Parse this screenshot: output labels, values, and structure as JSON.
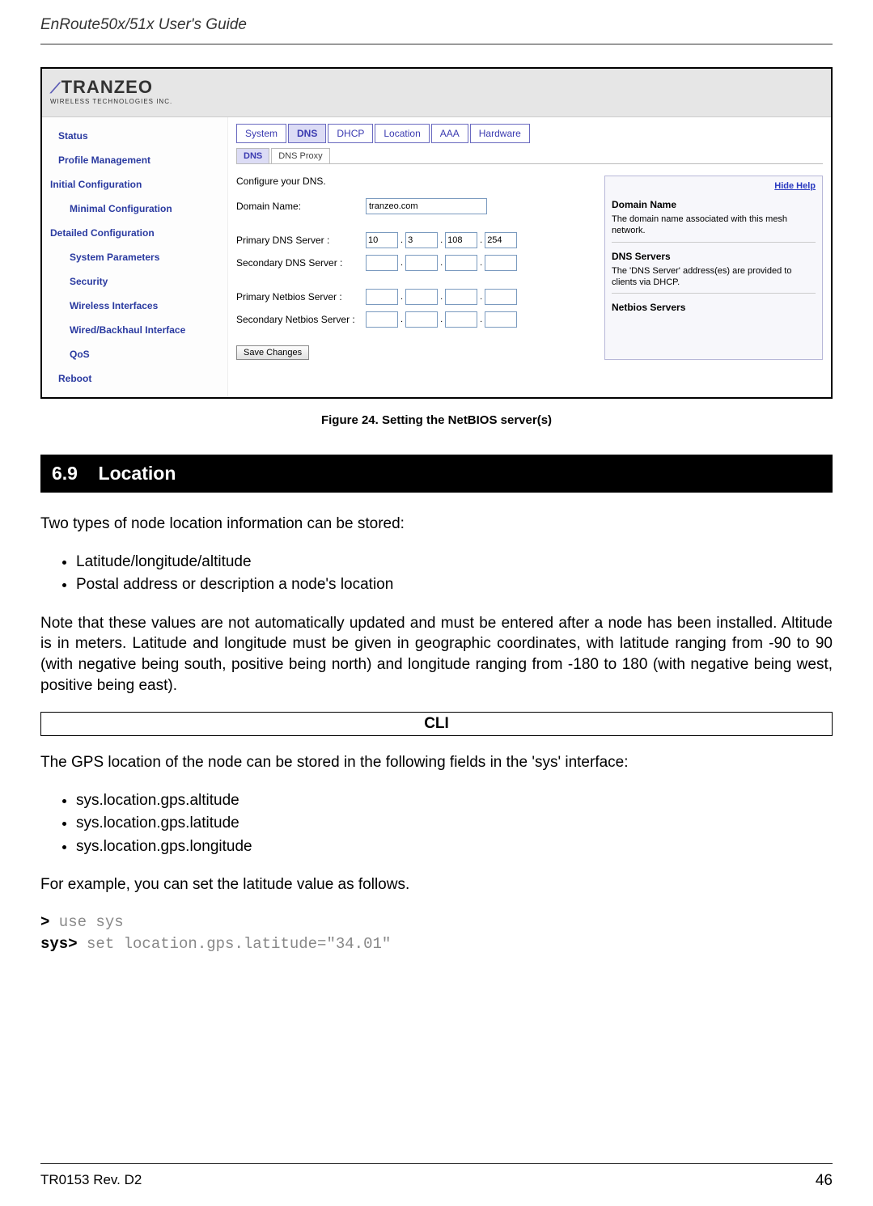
{
  "header": {
    "title": "EnRoute50x/51x User's Guide"
  },
  "screenshot": {
    "logo": {
      "brand": "TRANZEO",
      "sub": "WIRELESS TECHNOLOGIES INC."
    },
    "sidebar": {
      "items": [
        {
          "label": "Status",
          "type": "item"
        },
        {
          "label": "Profile Management",
          "type": "item"
        },
        {
          "label": "Initial Configuration",
          "type": "heading"
        },
        {
          "label": "Minimal Configuration",
          "type": "subitem"
        },
        {
          "label": "Detailed Configuration",
          "type": "heading"
        },
        {
          "label": "System Parameters",
          "type": "subitem"
        },
        {
          "label": "Security",
          "type": "subitem"
        },
        {
          "label": "Wireless Interfaces",
          "type": "subitem"
        },
        {
          "label": "Wired/Backhaul Interface",
          "type": "subitem"
        },
        {
          "label": "QoS",
          "type": "subitem"
        },
        {
          "label": "Reboot",
          "type": "item"
        }
      ]
    },
    "tabs1": [
      "System",
      "DNS",
      "DHCP",
      "Location",
      "AAA",
      "Hardware"
    ],
    "tabs1_active": 1,
    "tabs2": [
      "DNS",
      "DNS Proxy"
    ],
    "tabs2_active": 0,
    "form": {
      "title": "Configure your DNS.",
      "domain_label": "Domain Name:",
      "domain_value": "tranzeo.com",
      "pdns_label": "Primary DNS Server :",
      "pdns_oct": [
        "10",
        "3",
        "108",
        "254"
      ],
      "sdns_label": "Secondary DNS Server :",
      "sdns_oct": [
        "",
        "",
        "",
        ""
      ],
      "pnbs_label": "Primary Netbios Server :",
      "pnbs_oct": [
        "",
        "",
        "",
        ""
      ],
      "snbs_label": "Secondary Netbios Server :",
      "snbs_oct": [
        "",
        "",
        "",
        ""
      ],
      "save_label": "Save Changes"
    },
    "help": {
      "hide_label": "Hide Help",
      "h1": "Domain Name",
      "p1": "The domain name associated with this mesh network.",
      "h2": "DNS Servers",
      "p2": "The 'DNS Server' address(es) are provided to clients via DHCP.",
      "h3": "Netbios Servers"
    }
  },
  "figure_caption": "Figure 24. Setting the NetBIOS server(s)",
  "section": {
    "number": "6.9",
    "title": "Location"
  },
  "para1": "Two types of node location information can be stored:",
  "list1": [
    "Latitude/longitude/altitude",
    "Postal address or description a node's location"
  ],
  "para2": "Note that these values are not automatically updated and must be entered after a node has been installed. Altitude is in meters. Latitude and longitude must be given in geographic coordinates, with latitude ranging from -90 to 90 (with negative being south, positive being north) and longitude ranging from -180 to 180 (with negative being west, positive being east).",
  "cli_label": "CLI",
  "para3": "The GPS location of the node can be stored in the following fields in the 'sys' interface:",
  "list2": [
    "sys.location.gps.altitude",
    "sys.location.gps.latitude",
    "sys.location.gps.longitude"
  ],
  "para4": "For example, you can set the latitude value as follows.",
  "code": {
    "l1_prompt": ">",
    "l1_cmd": " use sys",
    "l2_prompt": "sys>",
    "l2_cmd": " set location.gps.latitude=\"34.01\""
  },
  "footer": {
    "left": "TR0153 Rev. D2",
    "right": "46"
  }
}
